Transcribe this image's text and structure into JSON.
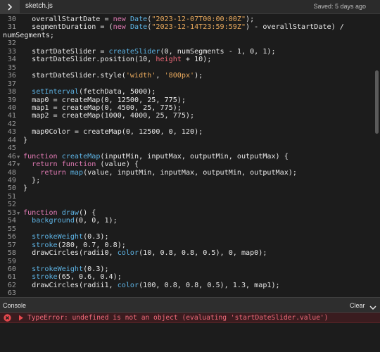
{
  "header": {
    "filename": "sketch.js",
    "saved_status": "Saved: 5 days ago"
  },
  "code": [
    {
      "n": "30",
      "fold": false,
      "tokens": [
        {
          "t": "  overallStartDate = "
        },
        {
          "t": "new",
          "c": "kw"
        },
        {
          "t": " "
        },
        {
          "t": "Date",
          "c": "fn"
        },
        {
          "t": "("
        },
        {
          "t": "\"2023-12-07T00:00:00Z\"",
          "c": "str"
        },
        {
          "t": ");"
        }
      ]
    },
    {
      "n": "31",
      "fold": false,
      "tokens": [
        {
          "t": "  segmentDuration = ("
        },
        {
          "t": "new",
          "c": "kw"
        },
        {
          "t": " "
        },
        {
          "t": "Date",
          "c": "fn"
        },
        {
          "t": "("
        },
        {
          "t": "\"2023-12-14T23:59:59Z\"",
          "c": "str"
        },
        {
          "t": ") - overallStartDate) /"
        }
      ]
    },
    {
      "n": "",
      "fold": false,
      "wrap": true,
      "tokens": [
        {
          "t": "numSegments;"
        }
      ]
    },
    {
      "n": "32",
      "fold": false,
      "tokens": []
    },
    {
      "n": "33",
      "fold": false,
      "tokens": [
        {
          "t": "  startDateSlider = "
        },
        {
          "t": "createSlider",
          "c": "fn"
        },
        {
          "t": "(0, numSegments - 1, 0, 1);"
        }
      ]
    },
    {
      "n": "34",
      "fold": false,
      "tokens": [
        {
          "t": "  startDateSlider.position(10, "
        },
        {
          "t": "height",
          "c": "red"
        },
        {
          "t": " + 10);"
        }
      ]
    },
    {
      "n": "35",
      "fold": false,
      "tokens": []
    },
    {
      "n": "36",
      "fold": false,
      "tokens": [
        {
          "t": "  startDateSlider.style("
        },
        {
          "t": "'width'",
          "c": "str"
        },
        {
          "t": ", "
        },
        {
          "t": "'800px'",
          "c": "str"
        },
        {
          "t": ");"
        }
      ]
    },
    {
      "n": "37",
      "fold": false,
      "tokens": []
    },
    {
      "n": "38",
      "fold": false,
      "tokens": [
        {
          "t": "  "
        },
        {
          "t": "setInterval",
          "c": "fn"
        },
        {
          "t": "(fetchData, 5000);"
        }
      ]
    },
    {
      "n": "39",
      "fold": false,
      "tokens": [
        {
          "t": "  map0 = createMap(0, 12500, 25, 775);"
        }
      ]
    },
    {
      "n": "40",
      "fold": false,
      "tokens": [
        {
          "t": "  map1 = createMap(0, 4500, 25, 775);"
        }
      ]
    },
    {
      "n": "41",
      "fold": false,
      "tokens": [
        {
          "t": "  map2 = createMap(1000, 4000, 25, 775);"
        }
      ]
    },
    {
      "n": "42",
      "fold": false,
      "tokens": []
    },
    {
      "n": "43",
      "fold": false,
      "tokens": [
        {
          "t": "  map0Color = createMap(0, 12500, 0, 120);"
        }
      ]
    },
    {
      "n": "44",
      "fold": false,
      "tokens": [
        {
          "t": "}"
        }
      ]
    },
    {
      "n": "45",
      "fold": false,
      "tokens": []
    },
    {
      "n": "46",
      "fold": true,
      "tokens": [
        {
          "t": "function",
          "c": "kw"
        },
        {
          "t": " "
        },
        {
          "t": "createMap",
          "c": "fn"
        },
        {
          "t": "(inputMin, inputMax, outputMin, outputMax) {"
        }
      ]
    },
    {
      "n": "47",
      "fold": true,
      "tokens": [
        {
          "t": "  "
        },
        {
          "t": "return",
          "c": "kw"
        },
        {
          "t": " "
        },
        {
          "t": "function",
          "c": "kw"
        },
        {
          "t": " (value) {"
        }
      ]
    },
    {
      "n": "48",
      "fold": false,
      "tokens": [
        {
          "t": "    "
        },
        {
          "t": "return",
          "c": "kw"
        },
        {
          "t": " "
        },
        {
          "t": "map",
          "c": "fn"
        },
        {
          "t": "(value, inputMin, inputMax, outputMin, outputMax);"
        }
      ]
    },
    {
      "n": "49",
      "fold": false,
      "tokens": [
        {
          "t": "  };"
        }
      ]
    },
    {
      "n": "50",
      "fold": false,
      "tokens": [
        {
          "t": "}"
        }
      ]
    },
    {
      "n": "51",
      "fold": false,
      "tokens": []
    },
    {
      "n": "52",
      "fold": false,
      "tokens": []
    },
    {
      "n": "53",
      "fold": true,
      "tokens": [
        {
          "t": "function",
          "c": "kw"
        },
        {
          "t": " "
        },
        {
          "t": "draw",
          "c": "fn"
        },
        {
          "t": "() {"
        }
      ]
    },
    {
      "n": "54",
      "fold": false,
      "tokens": [
        {
          "t": "  "
        },
        {
          "t": "background",
          "c": "fn"
        },
        {
          "t": "(0, 0, 1);"
        }
      ]
    },
    {
      "n": "55",
      "fold": false,
      "tokens": []
    },
    {
      "n": "56",
      "fold": false,
      "tokens": [
        {
          "t": "  "
        },
        {
          "t": "strokeWeight",
          "c": "fn"
        },
        {
          "t": "(0.3);"
        }
      ]
    },
    {
      "n": "57",
      "fold": false,
      "tokens": [
        {
          "t": "  "
        },
        {
          "t": "stroke",
          "c": "fn"
        },
        {
          "t": "(280, 0.7, 0.8);"
        }
      ]
    },
    {
      "n": "58",
      "fold": false,
      "tokens": [
        {
          "t": "  drawCircles(radii0, "
        },
        {
          "t": "color",
          "c": "fn"
        },
        {
          "t": "(10, 0.8, 0.8, 0.5), 0, map0);"
        }
      ]
    },
    {
      "n": "59",
      "fold": false,
      "tokens": []
    },
    {
      "n": "60",
      "fold": false,
      "tokens": [
        {
          "t": "  "
        },
        {
          "t": "strokeWeight",
          "c": "fn"
        },
        {
          "t": "(0.3);"
        }
      ]
    },
    {
      "n": "61",
      "fold": false,
      "tokens": [
        {
          "t": "  "
        },
        {
          "t": "stroke",
          "c": "fn"
        },
        {
          "t": "(65, 0.6, 0.4);"
        }
      ]
    },
    {
      "n": "62",
      "fold": false,
      "tokens": [
        {
          "t": "  drawCircles(radii1, "
        },
        {
          "t": "color",
          "c": "fn"
        },
        {
          "t": "(100, 0.8, 0.8, 0.5), 1.3, map1);"
        }
      ]
    },
    {
      "n": "63",
      "fold": false,
      "tokens": []
    }
  ],
  "console": {
    "title": "Console",
    "clear_label": "Clear",
    "error_message": "TypeError: undefined is not an object (evaluating 'startDateSlider.value')"
  },
  "colors": {
    "keyword": "#e07ab3",
    "function": "#5db3e4",
    "string": "#eaaa5d",
    "error": "#f16a7a"
  }
}
